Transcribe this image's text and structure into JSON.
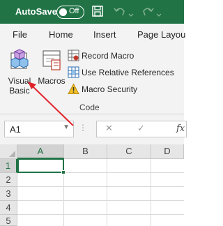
{
  "titlebar": {
    "autosave_label": "AutoSave",
    "autosave_state": "Off",
    "icons": [
      "save-icon",
      "undo-icon",
      "undo-dropdown-icon",
      "redo-icon",
      "redo-dropdown-icon"
    ]
  },
  "tabs": [
    "File",
    "Home",
    "Insert",
    "Page Layou"
  ],
  "ribbon": {
    "visual_basic": {
      "line1": "Visual",
      "line2": "Basic",
      "icon": "visual-basic-icon"
    },
    "macros": {
      "label": "Macros",
      "icon": "macros-icon"
    },
    "commands": [
      {
        "label": "Record Macro",
        "icon": "record-macro-icon"
      },
      {
        "label": "Use Relative References",
        "icon": "relative-references-icon"
      },
      {
        "label": "Macro Security",
        "icon": "warning-icon"
      }
    ],
    "group_label": "Code"
  },
  "formula_bar": {
    "name_box_value": "A1",
    "cancel_glyph": "✕",
    "enter_glyph": "✓",
    "fx_glyph": "fx",
    "dots": "⋮",
    "dropdown_glyph": "▼"
  },
  "grid": {
    "columns": [
      "A",
      "B",
      "C",
      "D"
    ],
    "rows": [
      "1",
      "2",
      "3",
      "4",
      "5"
    ],
    "active_cell": "A1"
  },
  "annotation": {
    "color": "#e0242b"
  },
  "colors": {
    "excel_green": "#217346",
    "ribbon_bg": "#f3f3f3"
  }
}
